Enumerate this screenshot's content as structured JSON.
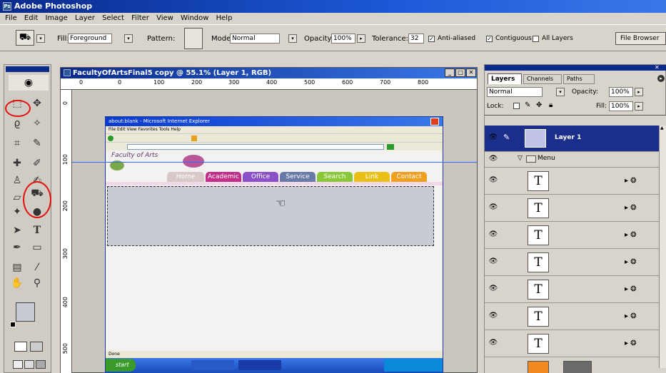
{
  "app": {
    "title": "Adobe Photoshop",
    "logo": "Ps"
  },
  "menu": [
    "File",
    "Edit",
    "Image",
    "Layer",
    "Select",
    "Filter",
    "View",
    "Window",
    "Help"
  ],
  "options": {
    "fill_label": "Fill:",
    "fill_value": "Foreground",
    "pattern_label": "Pattern:",
    "mode_label": "Mode:",
    "mode_value": "Normal",
    "opacity_label": "Opacity:",
    "opacity_value": "100%",
    "tolerance_label": "Tolerance:",
    "tolerance_value": "32",
    "anti_aliased": "Anti-aliased",
    "contiguous": "Contiguous",
    "all_layers": "All Layers",
    "file_browser": "File Browser"
  },
  "document": {
    "title": "FacultyOfArtsFinal5 copy @ 55.1% (Layer 1, RGB)",
    "ruler": [
      "0",
      "100",
      "200",
      "300",
      "400",
      "500",
      "600",
      "700",
      "800"
    ],
    "vruler": [
      "0",
      "100",
      "200",
      "300",
      "400",
      "500"
    ]
  },
  "ie": {
    "title": "about:blank - Microsoft Internet Explorer",
    "menu": "File  Edit  View  Favorites  Tools  Help",
    "logo_text": "Faculty of Arts",
    "tabs": [
      "Home",
      "Academic",
      "Office",
      "Service",
      "Search",
      "Link",
      "Contact"
    ],
    "start": "start",
    "status": "Done"
  },
  "panel": {
    "tabs": [
      "Layers",
      "Channels",
      "Paths"
    ],
    "blend": "Normal",
    "opacity_label": "Opacity:",
    "opacity_value": "100%",
    "lock_label": "Lock:",
    "fill_label": "Fill:",
    "fill_value": "100%",
    "layer1": "Layer 1",
    "group": "Menu",
    "text_glyph": "T"
  },
  "colors": {
    "accent": "#0a2a8c",
    "selected_layer": "#1c2e8c",
    "annotation": "#e01010"
  }
}
